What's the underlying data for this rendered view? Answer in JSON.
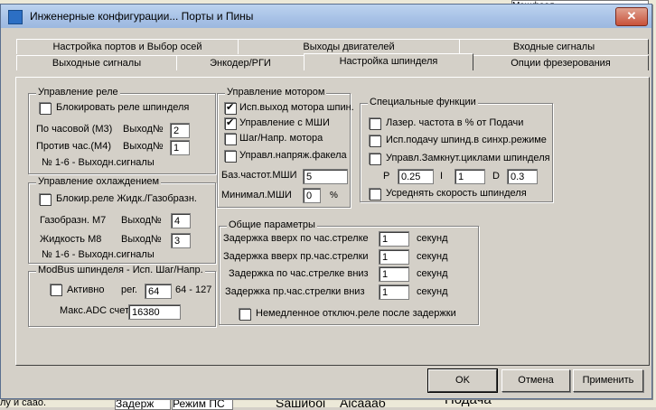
{
  "window": {
    "title": "Инженерные конфигурации... Порты и Пины",
    "close": "✕"
  },
  "tabs_row1": [
    {
      "label": "Настройка портов и Выбор осей"
    },
    {
      "label": "Выходы двигателей"
    },
    {
      "label": "Входные сигналы"
    }
  ],
  "tabs_row2": [
    {
      "label": "Выходные сигналы"
    },
    {
      "label": "Энкодер/РГИ"
    },
    {
      "label": "Настройка шпинделя"
    },
    {
      "label": "Опции фрезерования"
    }
  ],
  "relay": {
    "title": "Управление реле",
    "disable_label": "Блокировать реле шпинделя",
    "cw_label": "По часовой (М3)",
    "out_label": "Выход№",
    "cw_value": "2",
    "ccw_label": "Против час.(М4)",
    "ccw_value": "1",
    "note": "№ 1-6 - Выходн.сигналы"
  },
  "cooling": {
    "title": "Управление охлаждением",
    "disable_label": "Блокир.реле Жидк./Газобразн.",
    "gas_label": "Газобразн. М7",
    "out_label": "Выход№",
    "gas_value": "4",
    "liquid_label": "Жидкость  М8",
    "liquid_value": "3",
    "note": "№ 1-6 - Выходн.сигналы"
  },
  "modbus": {
    "title": "ModBus шпинделя - Исп. Шаг/Напр.",
    "active_label": "Активно",
    "reg_label": "рег.",
    "reg_value": "64",
    "range": "64 - 127",
    "adc_label": "Макс.ADC счет",
    "adc_value": "16380"
  },
  "motor": {
    "title": "Управление мотором",
    "opt1": "Исп.выход мотора шпин.",
    "opt2": "Управление с МШИ",
    "opt3": "Шаг/Напр. мотора",
    "opt4": "Управл.напряж.факела",
    "base_label": "Баз.частот.МШИ",
    "base_value": "5",
    "min_label": "Минимал.МШИ",
    "min_value": "0",
    "pct": "%"
  },
  "special": {
    "title": "Специальные функции",
    "opt1": "Лазер. частота в % от Подачи",
    "opt2": "Исп.подачу шпинд.в синхр.режиме",
    "opt3": "Управл.Замкнут.циклами шпинделя",
    "p_label": "P",
    "p_value": "0.25",
    "i_label": "I",
    "i_value": "1",
    "d_label": "D",
    "d_value": "0.3",
    "opt4": "Усреднять скорость шпинделя"
  },
  "general": {
    "title": "Общие параметры",
    "row1": "Задержка вверх по час.стрелке",
    "row1_value": "1",
    "row2": "Задержка вверх пр.час.стрелки",
    "row2_value": "1",
    "row3": "Задержка по час.стрелке вниз",
    "row3_value": "1",
    "row4": "Задержка пр.час.стрелки вниз",
    "row4_value": "1",
    "unit": "секунд",
    "immediate": "Немедленное отключ.реле после задержки"
  },
  "buttons": {
    "ok": "OK",
    "cancel": "Отмена",
    "apply": "Применить"
  },
  "background": {
    "top_right": "Мэшфоол",
    "bottom1": "Задерж",
    "bottom2": "Режим ПС",
    "bottom3": "Ѕашибоі",
    "bottom4": "Аісаааб",
    "bottom5": "Подача",
    "left_text": "лу и саао."
  }
}
